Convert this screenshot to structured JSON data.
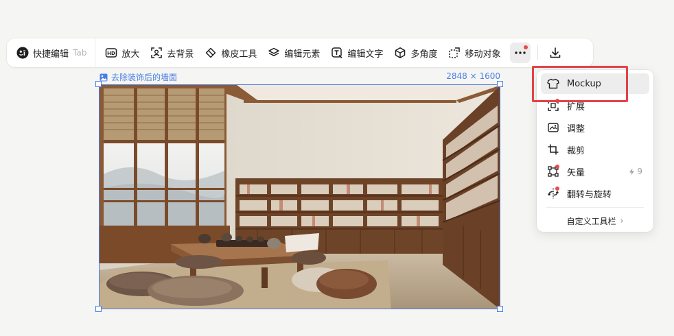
{
  "toolbar": {
    "quick_edit": "快捷编辑",
    "quick_edit_shortcut": "Tab",
    "items": [
      {
        "label": "放大",
        "icon": "hd-icon"
      },
      {
        "label": "去背景",
        "icon": "remove-bg-icon"
      },
      {
        "label": "橡皮工具",
        "icon": "eraser-icon"
      },
      {
        "label": "编辑元素",
        "icon": "layers-icon"
      },
      {
        "label": "编辑文字",
        "icon": "text-edit-icon"
      },
      {
        "label": "多角度",
        "icon": "cube-icon"
      },
      {
        "label": "移动对象",
        "icon": "move-object-icon"
      }
    ],
    "more_icon": "more-icon",
    "download_icon": "download-icon"
  },
  "canvas": {
    "image_label": "去除装饰后的墙面",
    "image_dimensions": "2848 × 1600"
  },
  "dropdown": {
    "items": [
      {
        "label": "Mockup",
        "icon": "tshirt-icon"
      },
      {
        "label": "扩展",
        "icon": "expand-icon"
      },
      {
        "label": "调整",
        "icon": "adjust-image-icon"
      },
      {
        "label": "裁剪",
        "icon": "crop-icon"
      },
      {
        "label": "矢量",
        "icon": "vector-icon",
        "extra": "9"
      },
      {
        "label": "翻转与旋转",
        "icon": "flip-rotate-icon"
      }
    ],
    "custom_toolbar": "自定义工具栏",
    "custom_toolbar_chevron": "›"
  },
  "colors": {
    "accent": "#4a7ee6",
    "highlight": "#e34346",
    "notification_dot": "#e84a4a"
  }
}
